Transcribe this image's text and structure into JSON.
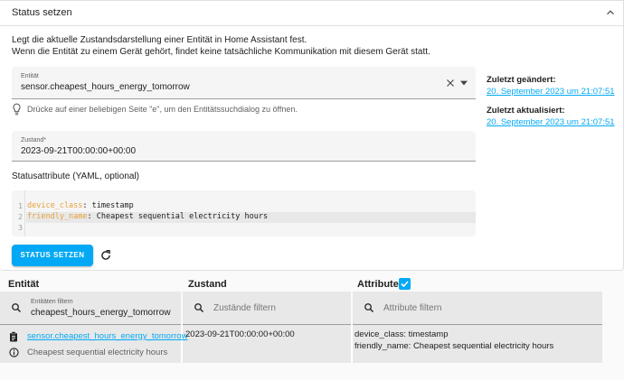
{
  "card": {
    "title": "Status setzen",
    "description_line1": "Legt die aktuelle Zustandsdarstellung einer Entität in Home Assistant fest.",
    "description_line2": "Wenn die Entität zu einem Gerät gehört, findet keine tatsächliche Kommunikation mit diesem Gerät statt."
  },
  "entity_field": {
    "label": "Entität",
    "value": "sensor.cheapest_hours_energy_tomorrow"
  },
  "hint": "Drücke auf einer beliebigen Seite \"e\", um den Entitätssuchdialog zu öffnen.",
  "state_field": {
    "label": "Zustand*",
    "value": "2023-09-21T00:00:00+00:00"
  },
  "attributes_label": "Statusattribute (YAML, optional)",
  "code": {
    "lines": [
      {
        "num": "1",
        "key": "device_class",
        "value": " timestamp"
      },
      {
        "num": "2",
        "key": "friendly_name",
        "value": " Cheapest sequential electricity hours"
      },
      {
        "num": "3",
        "key": "",
        "value": ""
      }
    ]
  },
  "set_state_button": "STATUS SETZEN",
  "sidebar": {
    "changed_label": "Zuletzt geändert:",
    "changed_value": "20. September 2023 um 21:07:51",
    "updated_label": "Zuletzt aktualisiert:",
    "updated_value": "20. September 2023 um 21:07:51"
  },
  "table": {
    "headers": {
      "entity": "Entität",
      "state": "Zustand",
      "attributes": "Attribute"
    },
    "attributes_checked": true,
    "filters": {
      "entity_label": "Entitäten filtern",
      "entity_value": "cheapest_hours_energy_tomorrow",
      "state_placeholder": "Zustände filtern",
      "attributes_placeholder": "Attribute filtern"
    },
    "row": {
      "entity_id": "sensor.cheapest_hours_energy_tomorrow",
      "friendly_name": "Cheapest sequential electricity hours",
      "state": "2023-09-21T00:00:00+00:00",
      "attr_line1": "device_class: timestamp",
      "attr_line2": "friendly_name: Cheapest sequential electricity hours"
    }
  },
  "colors": {
    "accent": "#03a9f4",
    "yaml_key": "#e6a23c"
  },
  "icons": [
    "chevron-up-icon",
    "close-icon",
    "dropdown-arrow-icon",
    "lightbulb-icon",
    "refresh-icon",
    "checkbox-checked-icon",
    "search-icon",
    "clipboard-icon",
    "info-icon"
  ]
}
